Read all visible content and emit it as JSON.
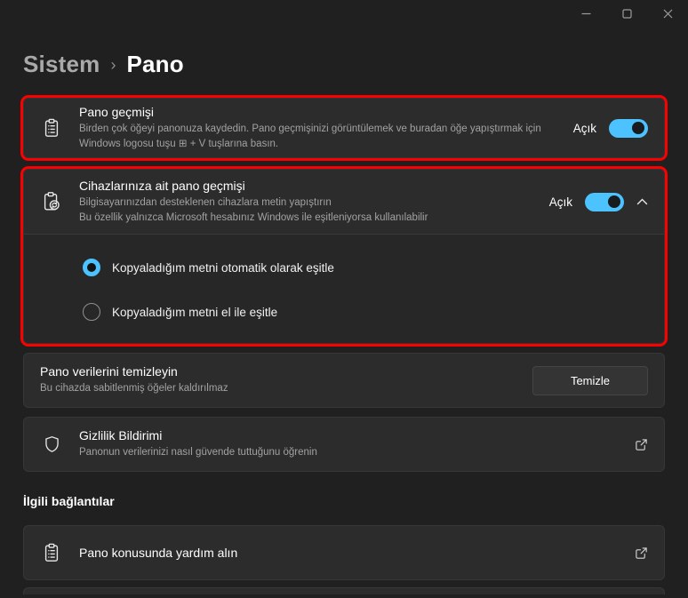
{
  "window": {
    "controls": {
      "minimize": "minimize",
      "maximize": "maximize",
      "close": "close"
    }
  },
  "breadcrumb": {
    "root": "Sistem",
    "separator": "›",
    "current": "Pano"
  },
  "colors": {
    "accent": "#4cc2ff",
    "annotation": "#fb0000",
    "page_bg": "#202020",
    "card_bg": "#2c2c2c"
  },
  "cards": {
    "clipboard_history": {
      "title": "Pano geçmişi",
      "description": "Birden çok öğeyi panonuza kaydedin. Pano geçmişinizi görüntülemek ve buradan öğe yapıştırmak için Windows logosu tuşu ⊞ + V tuşlarına basın.",
      "toggle_label": "Açık",
      "toggle_state": "on"
    },
    "device_history": {
      "title": "Cihazlarınıza ait pano geçmişi",
      "subtitle": "Bilgisayarınızdan desteklenen cihazlara metin yapıştırın",
      "note": "Bu özellik yalnızca Microsoft hesabınız Windows ile eşitleniyorsa kullanılabilir",
      "toggle_label": "Açık",
      "toggle_state": "on",
      "expanded": true,
      "options": [
        {
          "label": "Kopyaladığım metni otomatik olarak eşitle",
          "selected": true
        },
        {
          "label": "Kopyaladığım metni el ile eşitle",
          "selected": false
        }
      ]
    },
    "clear_data": {
      "title": "Pano verilerini temizleyin",
      "subtitle": "Bu cihazda sabitlenmiş öğeler kaldırılmaz",
      "button_label": "Temizle"
    },
    "privacy": {
      "title": "Gizlilik Bildirimi",
      "subtitle": "Panonun verilerinizi nasıl güvende tuttuğunu öğrenin"
    },
    "related": {
      "header": "İlgili bağlantılar",
      "help_title": "Pano konusunda yardım alın"
    }
  }
}
